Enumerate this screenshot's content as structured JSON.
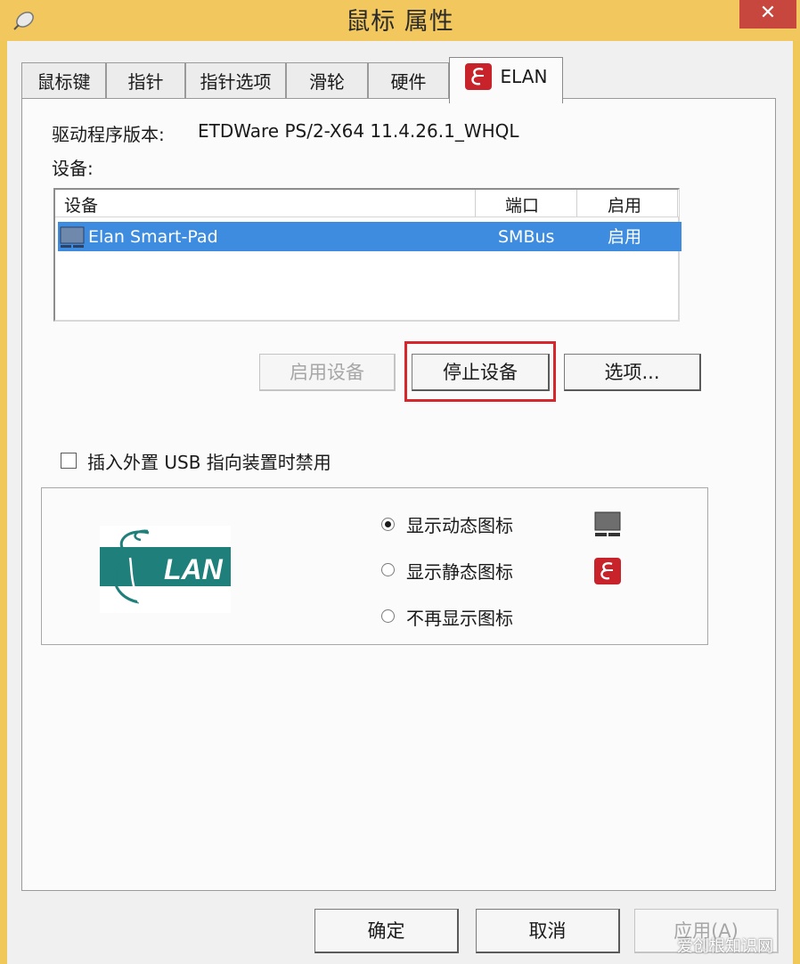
{
  "window": {
    "title": "鼠标 属性",
    "close_glyph": "✕"
  },
  "tabs": [
    {
      "label": "鼠标键"
    },
    {
      "label": "指针"
    },
    {
      "label": "指针选项"
    },
    {
      "label": "滑轮"
    },
    {
      "label": "硬件"
    },
    {
      "label": "ELAN",
      "active": true
    }
  ],
  "driver": {
    "label": "驱动程序版本:",
    "value": "ETDWare PS/2-X64 11.4.26.1_WHQL"
  },
  "devices": {
    "label": "设备:",
    "columns": [
      "设备",
      "端口",
      "启用"
    ],
    "rows": [
      {
        "name": "Elan Smart-Pad",
        "port": "SMBus",
        "enabled": "启用",
        "selected": true
      }
    ]
  },
  "buttons": {
    "enable_device": "启用设备",
    "stop_device": "停止设备",
    "options": "选项..."
  },
  "usb_disable": {
    "label": "插入外置 USB 指向装置时禁用",
    "checked": false
  },
  "icon_options": {
    "logo_text": "LAN",
    "items": [
      {
        "label": "显示动态图标",
        "selected": true
      },
      {
        "label": "显示静态图标",
        "selected": false
      },
      {
        "label": "不再显示图标",
        "selected": false
      }
    ]
  },
  "footer": {
    "ok": "确定",
    "cancel": "取消",
    "apply": "应用(A)"
  },
  "watermark": "爱创根知识网",
  "colors": {
    "titlebar": "#f2c75e",
    "selection": "#3d8ce0",
    "highlight_box": "#d7262c",
    "close_button": "#c7463e",
    "elan_red": "#c8222b",
    "elan_teal": "#1f7f7a"
  }
}
